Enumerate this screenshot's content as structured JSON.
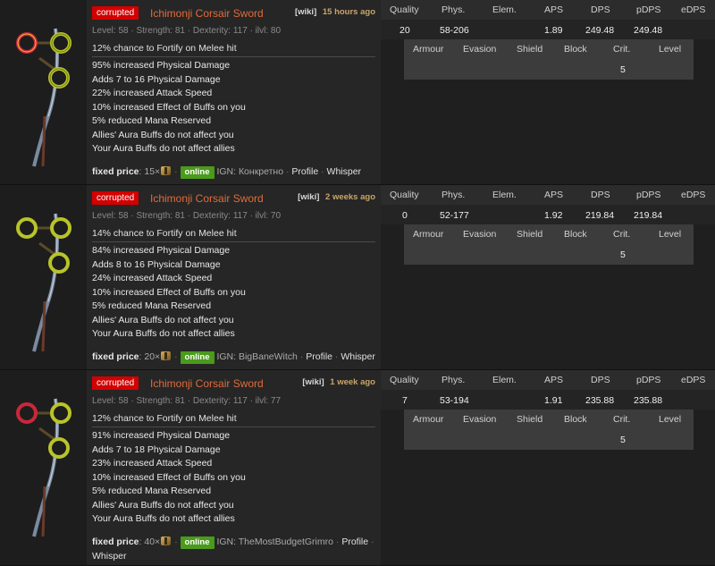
{
  "results": [
    {
      "corrupted_label": "corrupted",
      "name": "Ichimonji Corsair Sword",
      "wiki_label": "[wiki]",
      "listed_ago": "15 hours ago",
      "requirements": "Level: 58 · Strength: 81 · Dexterity: 117 · ilvl: 80",
      "implicit": "12% chance to Fortify on Melee hit",
      "mods": [
        "95% increased Physical Damage",
        "Adds 7 to 16 Physical Damage",
        "22% increased Attack Speed",
        "10% increased Effect of Buffs on you",
        "5% reduced Mana Reserved",
        "Allies' Aura Buffs do not affect you",
        "Your Aura Buffs do not affect allies"
      ],
      "price_label": "fixed price",
      "price_amount": "15×",
      "online_label": "online",
      "ign": "IGN: Конкретно",
      "profile_label": "Profile",
      "whisper_label": "Whisper",
      "stats": {
        "quality": "20",
        "phys": "58-206",
        "elem": "",
        "aps": "1.89",
        "dps": "249.48",
        "pdps": "249.48",
        "edps": ""
      },
      "defense": {
        "armour": "",
        "evasion": "",
        "shield": "",
        "block": "",
        "crit": "5",
        "level": ""
      }
    },
    {
      "corrupted_label": "corrupted",
      "name": "Ichimonji Corsair Sword",
      "wiki_label": "[wiki]",
      "listed_ago": "2 weeks ago",
      "requirements": "Level: 58 · Strength: 81 · Dexterity: 117 · ilvl: 70",
      "implicit": "14% chance to Fortify on Melee hit",
      "mods": [
        "84% increased Physical Damage",
        "Adds 8 to 16 Physical Damage",
        "24% increased Attack Speed",
        "10% increased Effect of Buffs on you",
        "5% reduced Mana Reserved",
        "Allies' Aura Buffs do not affect you",
        "Your Aura Buffs do not affect allies"
      ],
      "price_label": "fixed price",
      "price_amount": "20×",
      "online_label": "online",
      "ign": "IGN: BigBaneWitch",
      "profile_label": "Profile",
      "whisper_label": "Whisper",
      "stats": {
        "quality": "0",
        "phys": "52-177",
        "elem": "",
        "aps": "1.92",
        "dps": "219.84",
        "pdps": "219.84",
        "edps": ""
      },
      "defense": {
        "armour": "",
        "evasion": "",
        "shield": "",
        "block": "",
        "crit": "5",
        "level": ""
      }
    },
    {
      "corrupted_label": "corrupted",
      "name": "Ichimonji Corsair Sword",
      "wiki_label": "[wiki]",
      "listed_ago": "1 week ago",
      "requirements": "Level: 58 · Strength: 81 · Dexterity: 117 · ilvl: 77",
      "implicit": "12% chance to Fortify on Melee hit",
      "mods": [
        "91% increased Physical Damage",
        "Adds 7 to 18 Physical Damage",
        "23% increased Attack Speed",
        "10% increased Effect of Buffs on you",
        "5% reduced Mana Reserved",
        "Allies' Aura Buffs do not affect you",
        "Your Aura Buffs do not affect allies"
      ],
      "price_label": "fixed price",
      "price_amount": "40×",
      "online_label": "online",
      "ign": "IGN: TheMostBudgetGrimro",
      "profile_label": "Profile",
      "whisper_label": "Whisper",
      "stats": {
        "quality": "7",
        "phys": "53-194",
        "elem": "",
        "aps": "1.91",
        "dps": "235.88",
        "pdps": "235.88",
        "edps": ""
      },
      "defense": {
        "armour": "",
        "evasion": "",
        "shield": "",
        "block": "",
        "crit": "5",
        "level": ""
      }
    }
  ],
  "stat_headers": {
    "quality": "Quality",
    "phys": "Phys.",
    "elem": "Elem.",
    "aps": "APS",
    "dps": "DPS",
    "pdps": "pDPS",
    "edps": "eDPS"
  },
  "defense_headers": {
    "armour": "Armour",
    "evasion": "Evasion",
    "shield": "Shield",
    "block": "Block",
    "crit": "Crit.",
    "level": "Level"
  },
  "colors": {
    "corrupted": "#d20000",
    "item_name": "#e06b3a",
    "online": "#4a9a1c",
    "age": "#c8a56a"
  },
  "icons": {
    "item_art": "corsair-sword-art-icon",
    "currency": "exalted-orb-icon"
  }
}
